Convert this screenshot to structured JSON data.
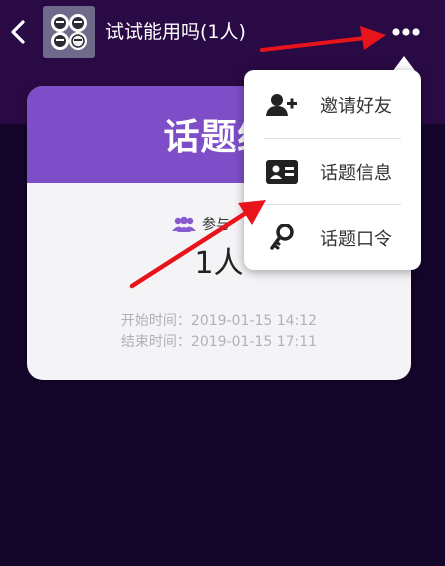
{
  "header": {
    "title": "试试能用吗(1人)",
    "back_icon": "chevron-left-icon",
    "more_icon": "more-dots-icon"
  },
  "card": {
    "title": "话题结",
    "participants_label": "参与",
    "participants_count": "1人",
    "start_time": "开始时间：2019-01-15 14:12",
    "end_time": "结束时间：2019-01-15 17:11"
  },
  "menu": {
    "items": [
      {
        "label": "邀请好友",
        "icon": "add-user-icon"
      },
      {
        "label": "话题信息",
        "icon": "id-card-icon"
      },
      {
        "label": "话题口令",
        "icon": "key-icon"
      }
    ]
  },
  "colors": {
    "topbar": "#2a0a44",
    "background": "#14052b",
    "card_header": "#7d4ec7",
    "accent": "#8a5bd0",
    "annotation_arrow": "#e8141b"
  }
}
